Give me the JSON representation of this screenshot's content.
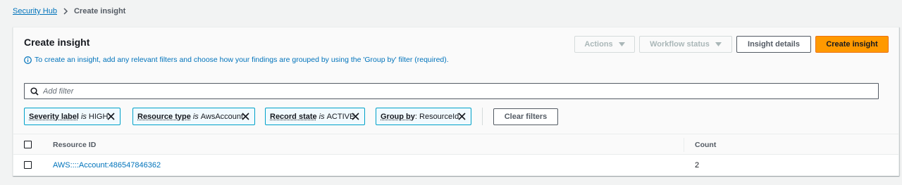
{
  "breadcrumb": {
    "root": "Security Hub",
    "current": "Create insight"
  },
  "panel": {
    "title": "Create insight",
    "info_text": "To create an insight, add any relevant filters and choose how your findings are grouped by using the 'Group by' filter (required)."
  },
  "buttons": {
    "actions": "Actions",
    "workflow_status": "Workflow status",
    "insight_details": "Insight details",
    "create_insight": "Create insight"
  },
  "filter": {
    "placeholder": "Add filter",
    "value": ""
  },
  "tokens": [
    {
      "key": "Severity label",
      "op": "is",
      "value": "HIGH"
    },
    {
      "key": "Resource type",
      "op": "is",
      "value": "AwsAccount"
    },
    {
      "key": "Record state",
      "op": "is",
      "value": "ACTIVE"
    },
    {
      "key": "Group by",
      "op": "",
      "value": ": ResourceId"
    }
  ],
  "clear_filters": "Clear filters",
  "table": {
    "headers": {
      "resource_id": "Resource ID",
      "count": "Count"
    },
    "rows": [
      {
        "resource_id": "AWS::::Account:486547846362",
        "count": "2"
      }
    ]
  },
  "colors": {
    "link": "#0073bb",
    "primary": "#ff9900",
    "token_border": "#00a1c9",
    "token_bg": "#f1faff"
  },
  "icons": [
    "chevron-right-icon",
    "info-icon",
    "caret-down-icon",
    "search-icon",
    "close-icon"
  ]
}
